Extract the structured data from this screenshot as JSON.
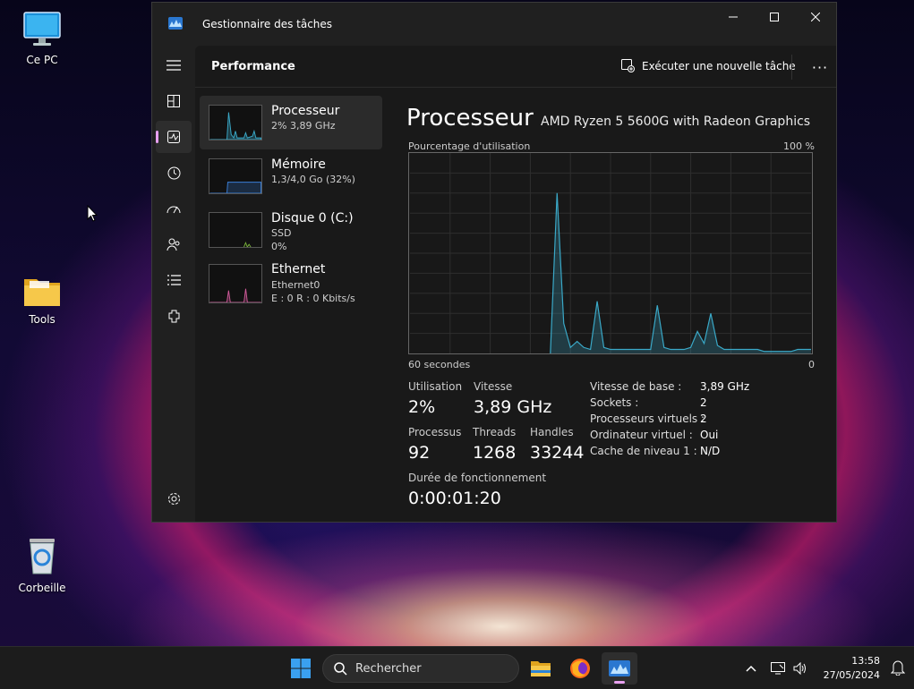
{
  "desktop": {
    "icons": [
      {
        "label": "Ce PC"
      },
      {
        "label": "Tools"
      },
      {
        "label": "Corbeille"
      }
    ]
  },
  "window": {
    "title": "Gestionnaire des tâches",
    "header": {
      "page_title": "Performance",
      "run_task_label": "Exécuter une nouvelle tâche",
      "more_label": "···"
    },
    "nav_icons": [
      "hamburger-icon",
      "processes-icon",
      "performance-icon",
      "history-icon",
      "startup-icon",
      "users-icon",
      "details-icon",
      "services-icon",
      "settings-icon"
    ],
    "devices": [
      {
        "name": "Processeur",
        "sub1": "2%  3,89 GHz",
        "sub2": "",
        "color": "#3aa9c8",
        "active": true
      },
      {
        "name": "Mémoire",
        "sub1": "1,3/4,0 Go (32%)",
        "sub2": "",
        "color": "#3a7fd8",
        "active": false
      },
      {
        "name": "Disque 0 (C:)",
        "sub1": "SSD",
        "sub2": "0%",
        "color": "#7ab43a",
        "active": false
      },
      {
        "name": "Ethernet",
        "sub1": "Ethernet0",
        "sub2": "E : 0 R : 0 Kbits/s",
        "color": "#d05a9a",
        "active": false
      }
    ],
    "detail": {
      "title": "Processeur",
      "model": "AMD Ryzen 5 5600G with Radeon Graphics",
      "usage_label": "Pourcentage d'utilisation",
      "max_label": "100 %",
      "time_label": "60 secondes",
      "min_label": "0",
      "stats": {
        "utilisation": {
          "k": "Utilisation",
          "v": "2%"
        },
        "vitesse": {
          "k": "Vitesse",
          "v": "3,89 GHz"
        },
        "processus": {
          "k": "Processus",
          "v": "92"
        },
        "threads": {
          "k": "Threads",
          "v": "1268"
        },
        "handles": {
          "k": "Handles",
          "v": "33244"
        },
        "uptime": {
          "k": "Durée de fonctionnement",
          "v": "0:00:01:20"
        }
      },
      "specs": [
        {
          "k": "Vitesse de base :",
          "v": "3,89 GHz"
        },
        {
          "k": "Sockets :",
          "v": "2"
        },
        {
          "k": "Processeurs virtuels :",
          "v": "2"
        },
        {
          "k": "Ordinateur virtuel :",
          "v": "Oui"
        },
        {
          "k": "Cache de niveau 1 :",
          "v": "N/D"
        }
      ]
    }
  },
  "chart_data": {
    "type": "area",
    "ylim": [
      0,
      100
    ],
    "x": [
      0,
      1,
      2,
      3,
      4,
      5,
      6,
      7,
      8,
      9,
      10,
      11,
      12,
      13,
      14,
      15,
      16,
      17,
      18,
      19,
      20,
      21,
      22,
      23,
      24,
      25,
      26,
      27,
      28,
      29,
      30,
      31,
      32,
      33,
      34,
      35,
      36,
      37,
      38,
      39,
      40,
      41,
      42,
      43,
      44,
      45,
      46,
      47,
      48,
      49,
      50,
      51,
      52,
      53,
      54,
      55,
      56,
      57,
      58,
      59,
      60
    ],
    "series": [
      {
        "values": [
          null,
          null,
          null,
          null,
          null,
          null,
          null,
          null,
          null,
          null,
          null,
          null,
          null,
          null,
          null,
          null,
          null,
          null,
          null,
          null,
          null,
          0,
          80,
          15,
          3,
          6,
          3,
          2,
          26,
          3,
          2,
          2,
          2,
          2,
          2,
          2,
          2,
          24,
          3,
          2,
          2,
          2,
          3,
          11,
          5,
          20,
          4,
          2,
          2,
          2,
          2,
          2,
          2,
          1,
          1,
          1,
          1,
          1,
          2,
          2,
          2
        ],
        "color": "#3aa9c8"
      }
    ]
  },
  "taskbar": {
    "search_placeholder": "Rechercher",
    "time": "13:58",
    "date": "27/05/2024"
  }
}
